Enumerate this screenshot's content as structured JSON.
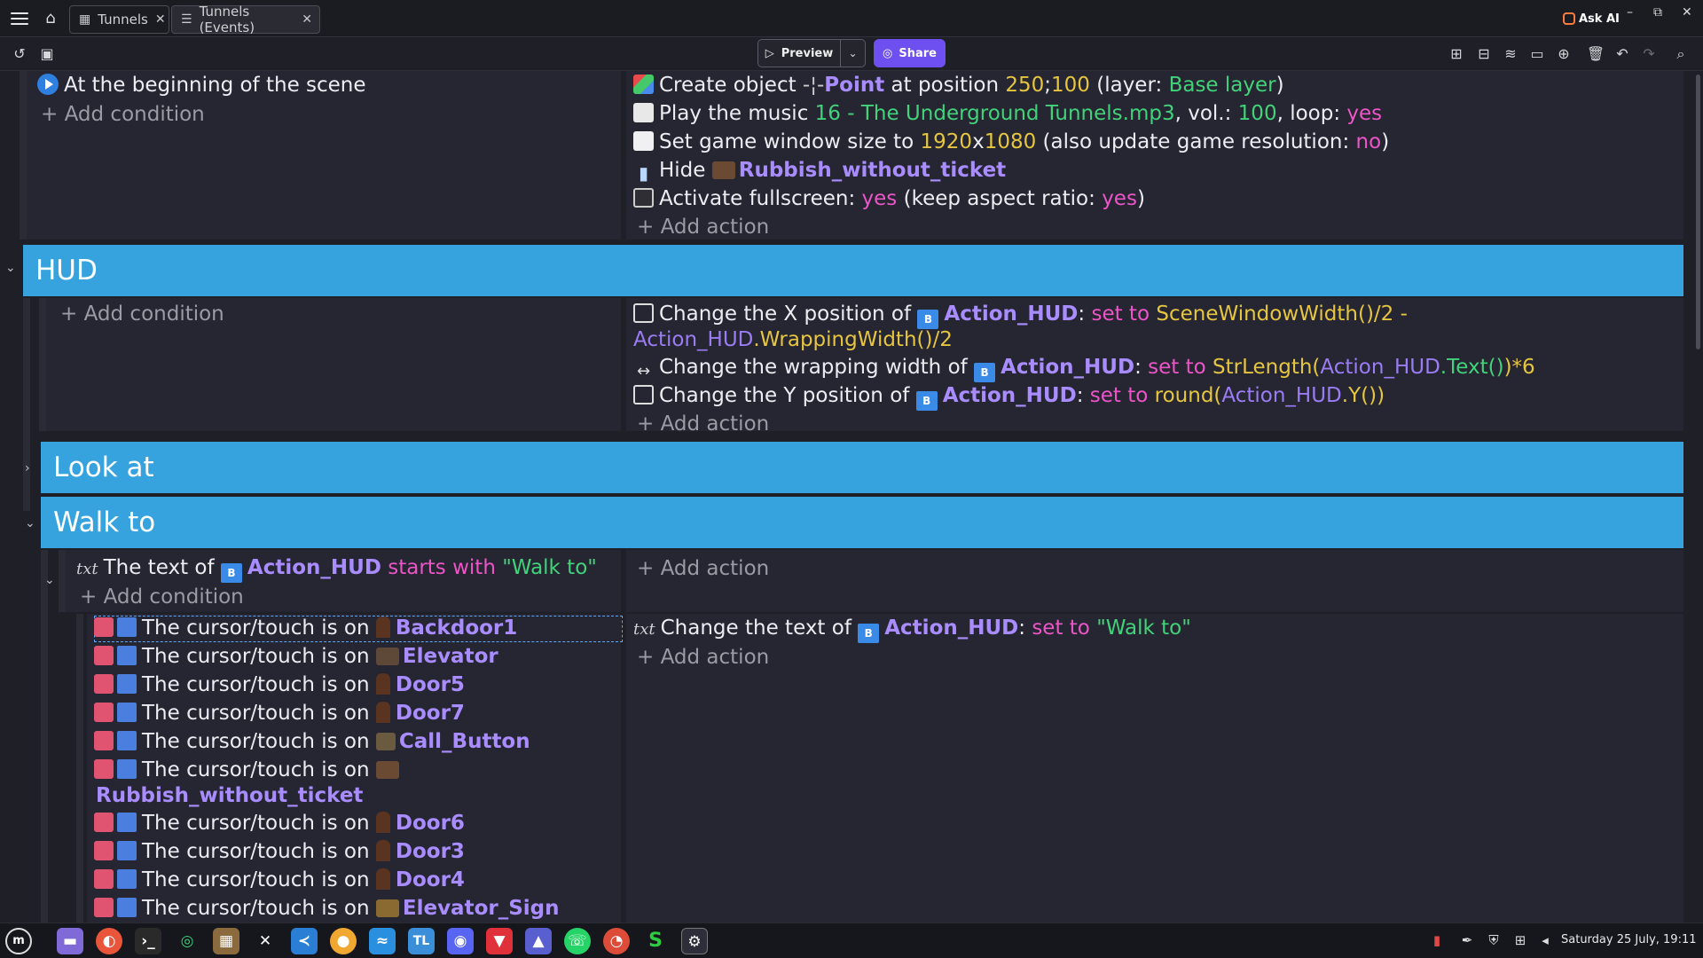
{
  "tabs": [
    {
      "label": "Tunnels",
      "icon": "film-icon"
    },
    {
      "label": "Tunnels (Events)",
      "icon": "events-icon"
    }
  ],
  "titlebar": {
    "ask_ai": "Ask AI"
  },
  "toolbar": {
    "preview": "Preview",
    "share": "Share"
  },
  "scene_event": {
    "condition": "At the beginning of the scene",
    "add_condition": "+ Add condition",
    "actions": {
      "a1": {
        "pre": "Create object ",
        "obj": "Point",
        "mid": " at position ",
        "x": "250",
        "sep": ";",
        "y": "100",
        "lp": " (layer: ",
        "layer": "Base layer",
        "rp": ")"
      },
      "a2": {
        "pre": "Play the music ",
        "file": "16 - The Underground Tunnels.mp3",
        "vol_l": ", vol.: ",
        "vol": "100",
        "loop_l": ", loop: ",
        "loop": "yes"
      },
      "a3": {
        "pre": "Set game window size to ",
        "w": "1920",
        "x": "x",
        "h": "1080",
        "mid": " (also update game resolution: ",
        "res": "no",
        "rp": ")"
      },
      "a4": {
        "pre": "Hide ",
        "obj": "Rubbish_without_ticket"
      },
      "a5": {
        "pre": "Activate fullscreen: ",
        "v": "yes",
        "mid": " (keep aspect ratio: ",
        "v2": "yes",
        "rp": ")"
      }
    },
    "add_action": "+ Add action"
  },
  "groups": {
    "hud": "HUD",
    "look": "Look at",
    "walk": "Walk to"
  },
  "hud_event": {
    "add_condition": "+ Add condition",
    "a1": {
      "pre": "Change the X position of ",
      "obj": "Action_HUD",
      "colon": ":",
      "set": " set to ",
      "expr1": "SceneWindowWidth()/2",
      "dash": " -",
      "expr2a": "Action_HUD",
      "expr2b": ".WrappingWidth()",
      "expr2c": "/2"
    },
    "a2": {
      "pre": "Change the wrapping width of ",
      "obj": "Action_HUD",
      "colon": ":",
      "set": " set to ",
      "e1": "StrLength(",
      "e2": "Action_HUD",
      "e3": ".Text()",
      "e4": ")*6"
    },
    "a3": {
      "pre": "Change the Y position of ",
      "obj": "Action_HUD",
      "colon": ":",
      "set": " set to ",
      "e1": "round(",
      "e2": "Action_HUD",
      "e3": ".Y()",
      "e4": ")"
    },
    "add_action": "+ Add action"
  },
  "walk_event": {
    "cond": {
      "pre": "The text of ",
      "obj": "Action_HUD",
      "mid": " starts with ",
      "val": "\"Walk to\""
    },
    "add_condition": "+ Add condition",
    "add_action": "+ Add action"
  },
  "cursor_event": {
    "prefix": "The cursor/touch is on ",
    "objects": [
      "Backdoor1",
      "Elevator",
      "Door5",
      "Door7",
      "Call_Button",
      "Rubbish_without_ticket",
      "Door6",
      "Door3",
      "Door4",
      "Elevator_Sign"
    ],
    "action": {
      "pre": "Change the text of ",
      "obj": "Action_HUD",
      "colon": ":",
      "set": " set to ",
      "val": "\"Walk to\""
    },
    "add_action": "+ Add action"
  },
  "taskbar": {
    "clock": "Saturday 25 July, 19:11",
    "tl": "TL",
    "s": "S"
  },
  "colors": {
    "group": "#36a3df",
    "object": "#a98cff",
    "green": "#42d27a",
    "yellow": "#e6c540",
    "pink": "#ec55c8",
    "share": "#6e4ff0"
  }
}
